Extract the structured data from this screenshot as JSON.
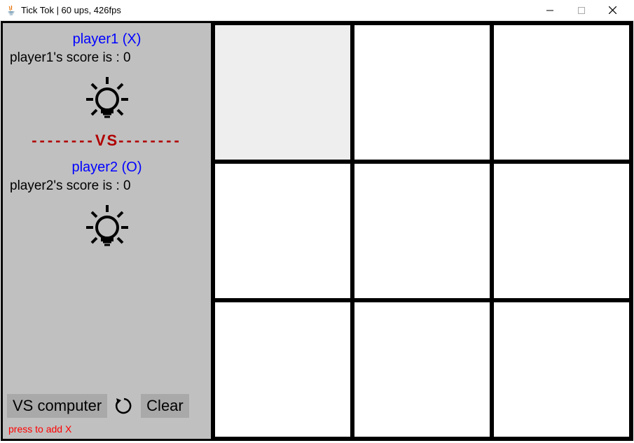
{
  "window": {
    "title": "Tick Tok  |  60 ups, 426fps"
  },
  "player1": {
    "name": "player1 (X)",
    "score_text": "player1's score is : 0"
  },
  "vs": {
    "dash": "--------",
    "label": "VS"
  },
  "player2": {
    "name": "player2 (O)",
    "score_text": "player2's score is : 0"
  },
  "controls": {
    "vs_computer": "VS computer",
    "clear": "Clear"
  },
  "hint": "press to add X",
  "board": {
    "cells": [
      "",
      "",
      "",
      "",
      "",
      "",
      "",
      "",
      ""
    ],
    "hovered_index": 0
  }
}
